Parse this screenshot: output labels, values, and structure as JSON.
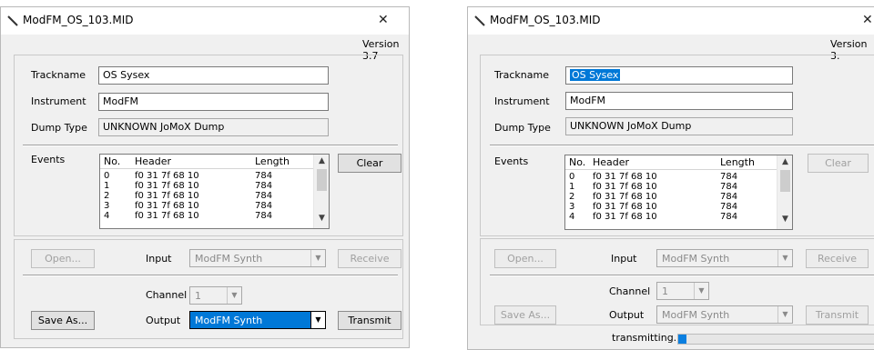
{
  "left": {
    "title": "ModFM_OS_103.MID",
    "close_glyph": "✕",
    "version": "Version 3.7",
    "trackname_label": "Trackname",
    "trackname_value": "OS Sysex",
    "instrument_label": "Instrument",
    "instrument_value": "ModFM",
    "dumptype_label": "Dump Type",
    "dumptype_value": "UNKNOWN JoMoX Dump",
    "events_label": "Events",
    "columns": [
      "No.",
      "Header",
      "Length"
    ],
    "rows": [
      [
        "0",
        "f0 31 7f 68 10",
        "784"
      ],
      [
        "1",
        "f0 31 7f 68 10",
        "784"
      ],
      [
        "2",
        "f0 31 7f 68 10",
        "784"
      ],
      [
        "3",
        "f0 31 7f 68 10",
        "784"
      ],
      [
        "4",
        "f0 31 7f 68 10",
        "784"
      ]
    ],
    "clear_label": "Clear",
    "open_label": "Open...",
    "input_label": "Input",
    "input_value": "ModFM Synth",
    "receive_label": "Receive",
    "channel_label": "Channel",
    "channel_value": "1",
    "saveas_label": "Save As...",
    "output_label": "Output",
    "output_value": "ModFM Synth",
    "transmit_label": "Transmit"
  },
  "right": {
    "title": "ModFM_OS_103.MID",
    "close_glyph": "✕",
    "version": "Version 3.",
    "trackname_label": "Trackname",
    "trackname_value": "OS Sysex",
    "instrument_label": "Instrument",
    "instrument_value": "ModFM",
    "dumptype_label": "Dump Type",
    "dumptype_value": "UNKNOWN JoMoX Dump",
    "events_label": "Events",
    "columns": [
      "No.",
      "Header",
      "Length"
    ],
    "rows": [
      [
        "0",
        "f0 31 7f 68 10",
        "784"
      ],
      [
        "1",
        "f0 31 7f 68 10",
        "784"
      ],
      [
        "2",
        "f0 31 7f 68 10",
        "784"
      ],
      [
        "3",
        "f0 31 7f 68 10",
        "784"
      ],
      [
        "4",
        "f0 31 7f 68 10",
        "784"
      ]
    ],
    "clear_label": "Clear",
    "open_label": "Open...",
    "input_label": "Input",
    "input_value": "ModFM Synth",
    "receive_label": "Receive",
    "channel_label": "Channel",
    "channel_value": "1",
    "saveas_label": "Save As...",
    "output_label": "Output",
    "output_value": "ModFM Synth",
    "transmit_label": "Transmit",
    "status_text": "transmitting...",
    "progress_fraction": 0.02
  },
  "colors": {
    "selection": "#0078d7",
    "dialog_bg": "#f0f0f0",
    "progress_fill": "#0a7fe0"
  },
  "icons": {
    "app": "pencil-icon",
    "close": "close-icon",
    "scroll_up": "chevron-up-icon",
    "scroll_down": "chevron-down-icon",
    "dropdown": "dropdown-arrow-icon"
  }
}
